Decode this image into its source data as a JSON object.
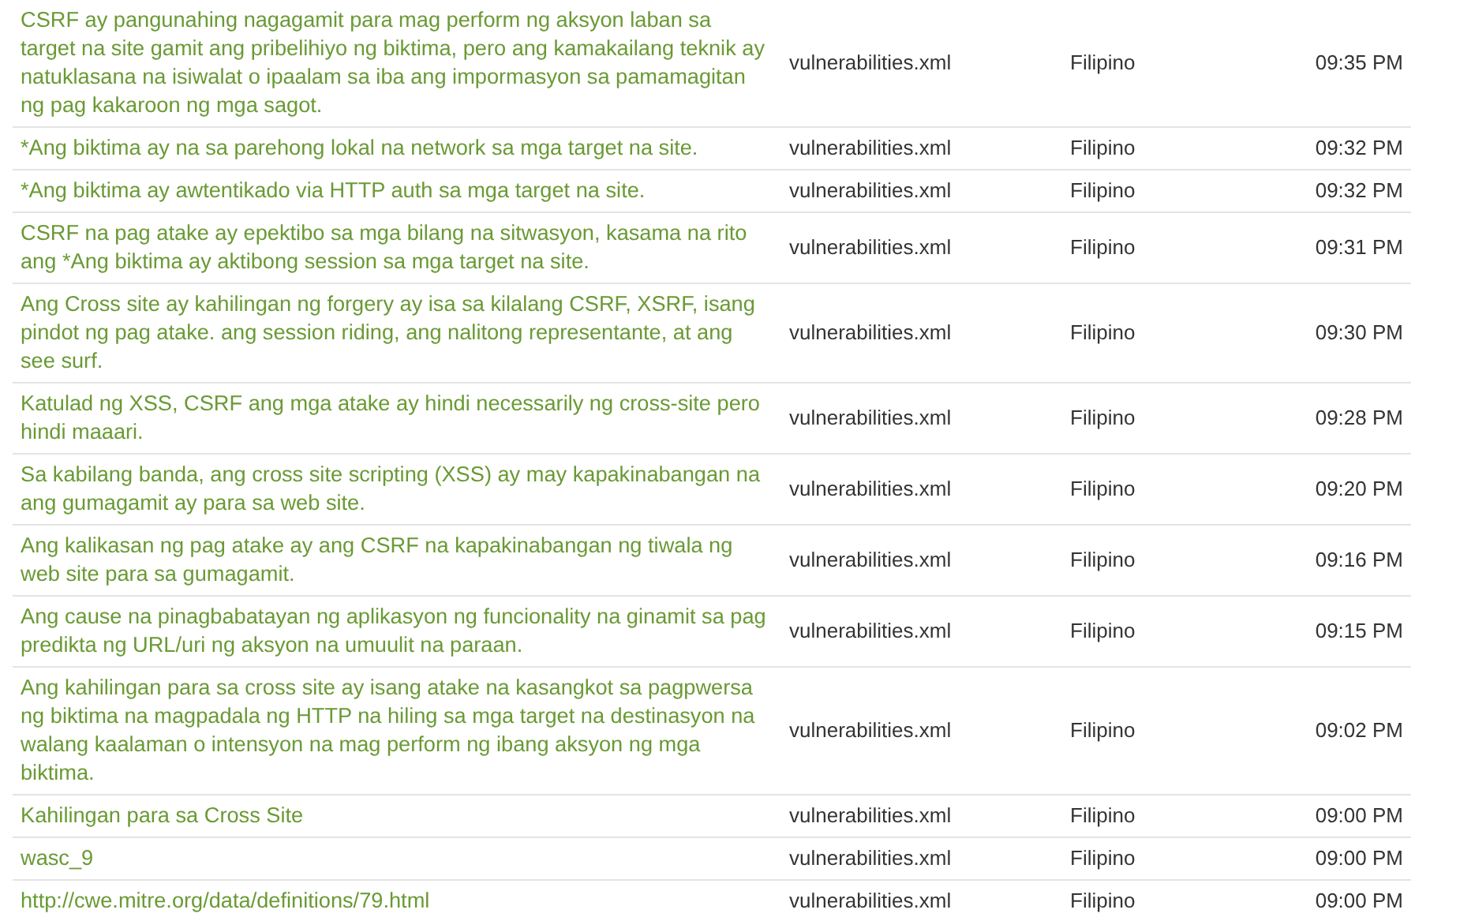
{
  "rows": [
    {
      "text": "CSRF ay pangunahing nagagamit para mag perform ng aksyon laban sa target na site gamit ang pribelihiyo ng biktima, pero ang kamakailang teknik ay natuklasana na isiwalat o ipaalam sa iba ang impormasyon sa pamamagitan ng pag kakaroon ng mga sagot.",
      "file": "vulnerabilities.xml",
      "language": "Filipino",
      "time": "09:35 PM"
    },
    {
      "text": "*Ang biktima ay na sa parehong lokal na network sa mga target na site.",
      "file": "vulnerabilities.xml",
      "language": "Filipino",
      "time": "09:32 PM"
    },
    {
      "text": "*Ang biktima ay awtentikado via HTTP auth sa mga target na site.",
      "file": "vulnerabilities.xml",
      "language": "Filipino",
      "time": "09:32 PM"
    },
    {
      "text": "CSRF na pag atake ay epektibo sa mga bilang na sitwasyon, kasama na rito ang *Ang biktima ay aktibong session sa mga target na site.",
      "file": "vulnerabilities.xml",
      "language": "Filipino",
      "time": "09:31 PM"
    },
    {
      "text": "Ang Cross site ay kahilingan ng forgery ay isa sa kilalang CSRF, XSRF, isang pindot ng pag atake. ang session riding, ang nalitong representante, at ang see surf.",
      "file": "vulnerabilities.xml",
      "language": "Filipino",
      "time": "09:30 PM"
    },
    {
      "text": "Katulad ng XSS, CSRF ang mga atake ay hindi necessarily ng cross-site pero hindi maaari.",
      "file": "vulnerabilities.xml",
      "language": "Filipino",
      "time": "09:28 PM"
    },
    {
      "text": "Sa kabilang banda, ang cross site scripting (XSS) ay may kapakinabangan na ang gumagamit ay para sa web site.",
      "file": "vulnerabilities.xml",
      "language": "Filipino",
      "time": "09:20 PM"
    },
    {
      "text": "Ang kalikasan ng pag atake ay ang CSRF na kapakinabangan ng tiwala ng web site para sa gumagamit.",
      "file": "vulnerabilities.xml",
      "language": "Filipino",
      "time": "09:16 PM"
    },
    {
      "text": "Ang cause na pinagbabatayan ng aplikasyon ng funcionality na ginamit sa pag predikta ng URL/uri ng aksyon na umuulit na paraan.",
      "file": "vulnerabilities.xml",
      "language": "Filipino",
      "time": "09:15 PM"
    },
    {
      "text": "Ang kahilingan para sa cross site ay isang atake na kasangkot sa pagpwersa ng biktima na magpadala ng HTTP na hiling sa mga target na destinasyon na walang kaalaman o intensyon na mag perform ng ibang aksyon ng mga biktima.",
      "file": "vulnerabilities.xml",
      "language": "Filipino",
      "time": "09:02 PM"
    },
    {
      "text": "Kahilingan para sa Cross Site",
      "file": "vulnerabilities.xml",
      "language": "Filipino",
      "time": "09:00 PM"
    },
    {
      "text": "wasc_9",
      "file": "vulnerabilities.xml",
      "language": "Filipino",
      "time": "09:00 PM"
    },
    {
      "text": "http://cwe.mitre.org/data/definitions/79.html",
      "file": "vulnerabilities.xml",
      "language": "Filipino",
      "time": "09:00 PM"
    }
  ]
}
